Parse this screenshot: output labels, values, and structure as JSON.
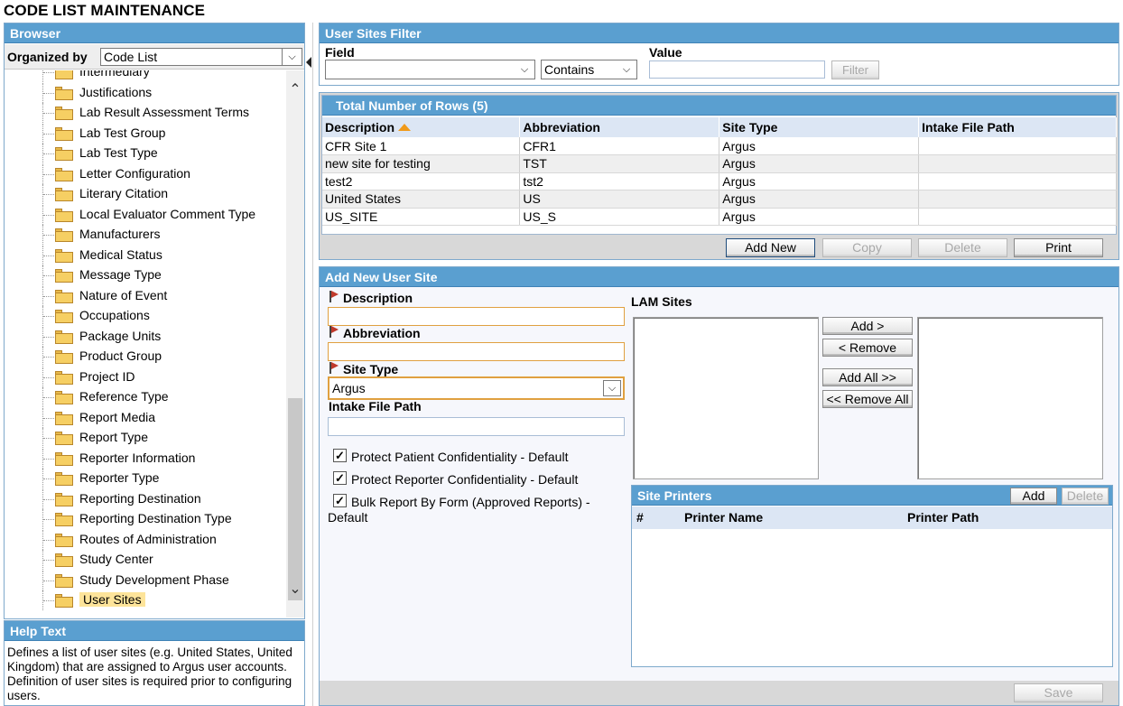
{
  "page_title": "CODE LIST MAINTENANCE",
  "browser": {
    "header": "Browser",
    "organized_by_label": "Organized by",
    "organized_by_value": "Code List",
    "tree_items": [
      "Intermediary",
      "Justifications",
      "Lab Result Assessment Terms",
      "Lab Test Group",
      "Lab Test Type",
      "Letter Configuration",
      "Literary Citation",
      "Local Evaluator Comment Type",
      "Manufacturers",
      "Medical Status",
      "Message Type",
      "Nature of Event",
      "Occupations",
      "Package Units",
      "Product Group",
      "Project ID",
      "Reference Type",
      "Report Media",
      "Report Type",
      "Reporter Information",
      "Reporter Type",
      "Reporting Destination",
      "Reporting Destination Type",
      "Routes of Administration",
      "Study Center",
      "Study Development Phase",
      "User Sites"
    ],
    "selected_item": "User Sites"
  },
  "help": {
    "header": "Help Text",
    "text": "Defines a list of user sites (e.g. United States, United Kingdom) that are assigned to Argus user accounts. Definition of user sites is required prior to configuring users."
  },
  "filter": {
    "header": "User Sites Filter",
    "field_label": "Field",
    "field_value": "",
    "operator_value": "Contains",
    "value_label": "Value",
    "value_value": "",
    "filter_button": "Filter"
  },
  "results": {
    "header": "Total Number of Rows (5)",
    "columns": [
      "Description",
      "Abbreviation",
      "Site Type",
      "Intake File Path"
    ],
    "rows": [
      [
        "CFR Site 1",
        "CFR1",
        "Argus",
        ""
      ],
      [
        "new site for testing",
        "TST",
        "Argus",
        ""
      ],
      [
        "test2",
        "tst2",
        "Argus",
        ""
      ],
      [
        "United States",
        "US",
        "Argus",
        ""
      ],
      [
        "US_SITE",
        "US_S",
        "Argus",
        ""
      ]
    ],
    "buttons": {
      "add_new": "Add New",
      "copy": "Copy",
      "delete": "Delete",
      "print": "Print"
    }
  },
  "form": {
    "header": "Add New User Site",
    "description_label": "Description",
    "description_value": "",
    "abbreviation_label": "Abbreviation",
    "abbreviation_value": "",
    "site_type_label": "Site Type",
    "site_type_value": "Argus",
    "intake_label": "Intake File Path",
    "intake_value": "",
    "cb1_label": "Protect Patient Confidentiality - Default",
    "cb1_checked": true,
    "cb2_label": "Protect Reporter Confidentiality - Default",
    "cb2_checked": true,
    "cb3_label_line1": "Bulk Report By Form (Approved Reports) -",
    "cb3_label_line2": "Default",
    "cb3_checked": true,
    "lam_label": "LAM Sites",
    "lam_buttons": {
      "add": "Add >",
      "remove": "< Remove",
      "add_all": "Add All >>",
      "remove_all": "<< Remove All"
    },
    "printers": {
      "header": "Site Printers",
      "add_button": "Add",
      "delete_button": "Delete",
      "columns": [
        "#",
        "Printer Name",
        "Printer Path"
      ]
    },
    "save_button": "Save"
  },
  "icons": {
    "dropdown": "chevron-down-icon",
    "sort": "sort-ascending-icon",
    "folder": "folder-icon",
    "required": "required-flag-icon"
  },
  "colors": {
    "header_blue": "#5a9fd0",
    "selected_highlight": "#fde49a",
    "required_border": "#e0a040"
  }
}
